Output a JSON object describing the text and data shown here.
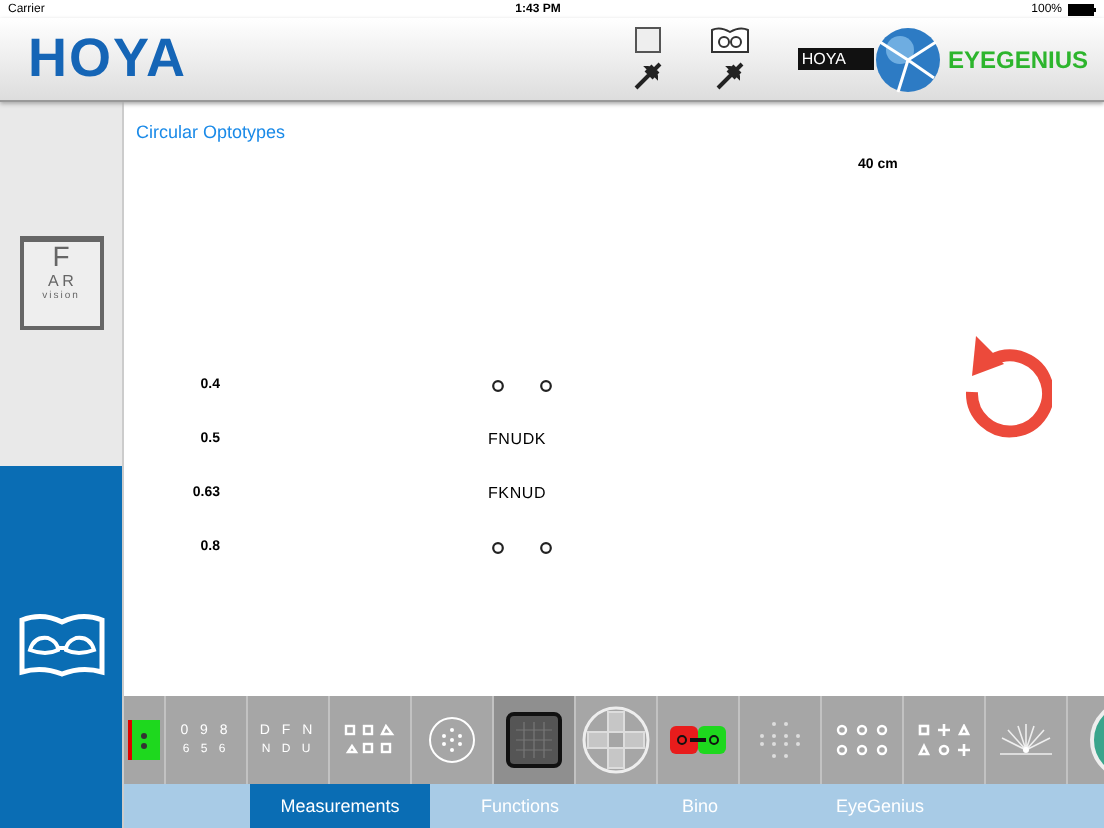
{
  "status_bar": {
    "carrier": "Carrier",
    "time": "1:43 PM",
    "battery": "100%"
  },
  "header": {
    "logo": "HOYA",
    "brand_badge": "HOYA",
    "brand_name": "EYEGENIUS"
  },
  "sidebar": {
    "items": [
      {
        "kind": "far",
        "letters_top": "F",
        "letters_mid": "A R",
        "caption": "vision",
        "selected": false
      },
      {
        "kind": "near",
        "selected": true
      }
    ]
  },
  "content": {
    "title": "Circular Optotypes",
    "distance": "40 cm",
    "rows": [
      {
        "acuity": "0.4",
        "kind": "rings"
      },
      {
        "acuity": "0.5",
        "kind": "letters",
        "text": "FNUDK"
      },
      {
        "acuity": "0.63",
        "kind": "letters",
        "text": "FKNUD"
      },
      {
        "acuity": "0.8",
        "kind": "rings"
      }
    ]
  },
  "thumbnails": [
    {
      "kind": "green",
      "selected": false
    },
    {
      "kind": "text",
      "line1": "0 9 8",
      "line2": "6 5 6",
      "selected": false
    },
    {
      "kind": "text",
      "line1": "D F N",
      "line2": "N D U",
      "selected": false
    },
    {
      "kind": "shapes",
      "selected": false
    },
    {
      "kind": "dot-circle",
      "selected": false
    },
    {
      "kind": "grid",
      "selected": true
    },
    {
      "kind": "cross",
      "selected": false
    },
    {
      "kind": "bino",
      "selected": false
    },
    {
      "kind": "dots",
      "selected": false
    },
    {
      "kind": "rings",
      "selected": false
    },
    {
      "kind": "symbols",
      "selected": false
    },
    {
      "kind": "fan",
      "selected": false
    },
    {
      "kind": "plate",
      "selected": false
    }
  ],
  "tabs": [
    {
      "label": "Measurements",
      "selected": true
    },
    {
      "label": "Functions",
      "selected": false
    },
    {
      "label": "Bino",
      "selected": false
    },
    {
      "label": "EyeGenius",
      "selected": false
    }
  ]
}
